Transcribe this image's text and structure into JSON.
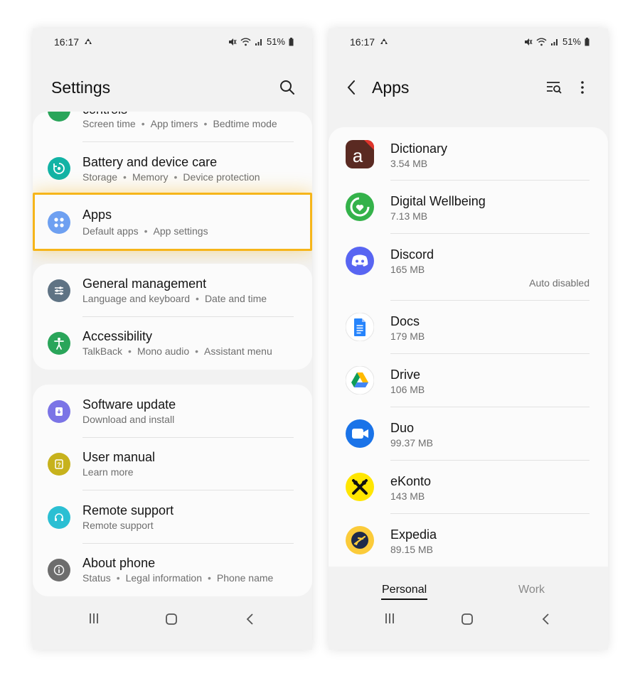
{
  "status_bar": {
    "time": "16:17",
    "battery": "51%"
  },
  "left_screen": {
    "title": "Settings",
    "partial_item": {
      "label": "controls",
      "subtitle_parts": [
        "Screen time",
        "App timers",
        "Bedtime mode"
      ]
    },
    "items": [
      {
        "id": "battery",
        "label": "Battery and device care",
        "subtitle_parts": [
          "Storage",
          "Memory",
          "Device protection"
        ],
        "icon_color": "#12b3a5"
      },
      {
        "id": "apps",
        "label": "Apps",
        "subtitle_parts": [
          "Default apps",
          "App settings"
        ],
        "icon_color": "#6ea0f1",
        "highlighted": true
      },
      {
        "id": "general",
        "label": "General management",
        "subtitle_parts": [
          "Language and keyboard",
          "Date and time"
        ],
        "icon_color": "#5f7384"
      },
      {
        "id": "accessibility",
        "label": "Accessibility",
        "subtitle_parts": [
          "TalkBack",
          "Mono audio",
          "Assistant menu"
        ],
        "icon_color": "#2aa55a"
      },
      {
        "id": "software",
        "label": "Software update",
        "subtitle_parts": [
          "Download and install"
        ],
        "icon_color": "#7b74e6"
      },
      {
        "id": "manual",
        "label": "User manual",
        "subtitle_parts": [
          "Learn more"
        ],
        "icon_color": "#c7b21c"
      },
      {
        "id": "remote",
        "label": "Remote support",
        "subtitle_parts": [
          "Remote support"
        ],
        "icon_color": "#2bbfd3"
      },
      {
        "id": "about",
        "label": "About phone",
        "subtitle_parts": [
          "Status",
          "Legal information",
          "Phone name"
        ],
        "icon_color": "#6d6d6d"
      }
    ]
  },
  "right_screen": {
    "title": "Apps",
    "apps": [
      {
        "name": "Dictionary",
        "size": "3.54 MB",
        "icon": "dictionary-icon"
      },
      {
        "name": "Digital Wellbeing",
        "size": "7.13 MB",
        "icon": "digital-wellbeing-icon"
      },
      {
        "name": "Discord",
        "size": "165 MB",
        "note": "Auto disabled",
        "icon": "discord-icon"
      },
      {
        "name": "Docs",
        "size": "179 MB",
        "icon": "docs-icon"
      },
      {
        "name": "Drive",
        "size": "106 MB",
        "icon": "drive-icon"
      },
      {
        "name": "Duo",
        "size": "99.37 MB",
        "icon": "duo-icon"
      },
      {
        "name": "eKonto",
        "size": "143 MB",
        "icon": "ekonto-icon"
      },
      {
        "name": "Expedia",
        "size": "89.15 MB",
        "icon": "expedia-icon"
      }
    ],
    "tabs": {
      "personal": "Personal",
      "work": "Work",
      "selected": "Personal"
    }
  }
}
